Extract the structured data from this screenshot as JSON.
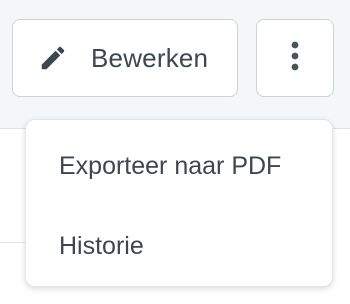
{
  "toolbar": {
    "edit_label": "Bewerken",
    "edit_icon": "pencil-icon",
    "more_icon": "more-vertical-icon"
  },
  "menu": {
    "items": [
      {
        "label": "Exporteer naar PDF"
      },
      {
        "label": "Historie"
      }
    ]
  },
  "colors": {
    "text": "#3d4750",
    "icon": "#3d4750",
    "border": "#cdd3d9",
    "background": "#f4f6f8"
  }
}
